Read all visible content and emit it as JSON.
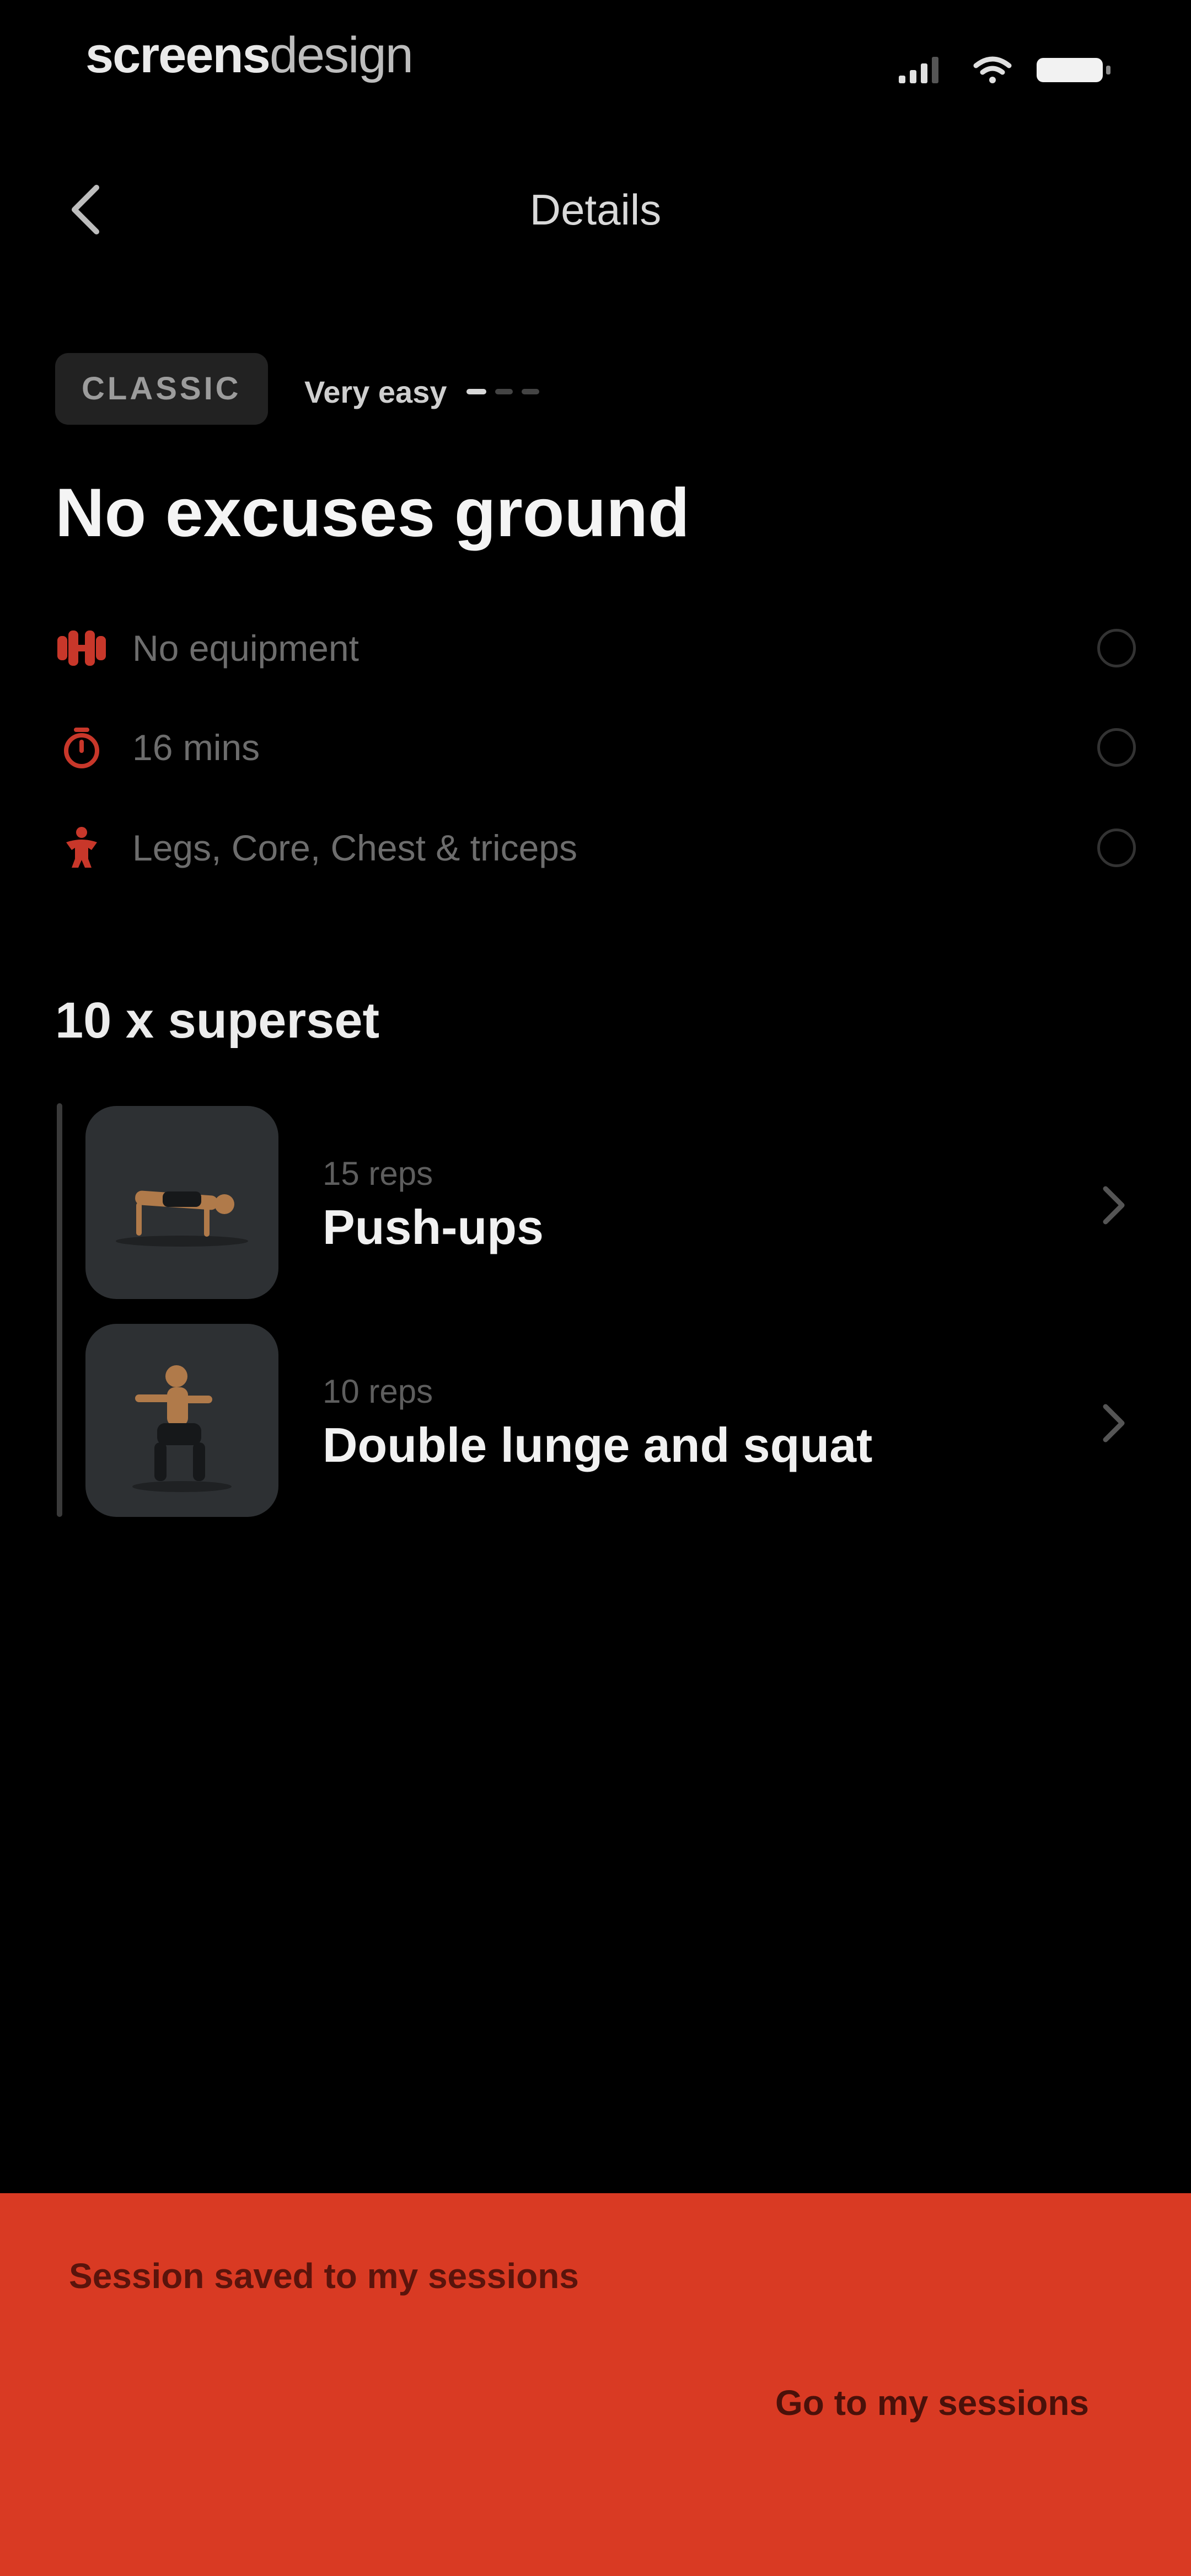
{
  "status_bar": {
    "brand_bold": "screens",
    "brand_light": "design"
  },
  "nav": {
    "title": "Details"
  },
  "workout": {
    "tag": "CLASSIC",
    "difficulty_label": "Very easy",
    "difficulty_level": 1,
    "difficulty_max": 3,
    "title": "No excuses ground",
    "info": [
      {
        "icon": "dumbbell-icon",
        "text": "No equipment"
      },
      {
        "icon": "stopwatch-icon",
        "text": "16 mins"
      },
      {
        "icon": "body-icon",
        "text": "Legs, Core, Chest & triceps"
      }
    ]
  },
  "superset": {
    "title": "10 x superset",
    "exercises": [
      {
        "reps": "15 reps",
        "name": "Push-ups",
        "thumb": "push-up-thumbnail"
      },
      {
        "reps": "10 reps",
        "name": "Double lunge and squat",
        "thumb": "squat-thumbnail"
      }
    ]
  },
  "snackbar": {
    "message": "Session saved to my sessions",
    "action": "Go to my sessions"
  },
  "colors": {
    "background": "#000000",
    "accent": "#d93a23",
    "icon_red": "#c8372a"
  }
}
